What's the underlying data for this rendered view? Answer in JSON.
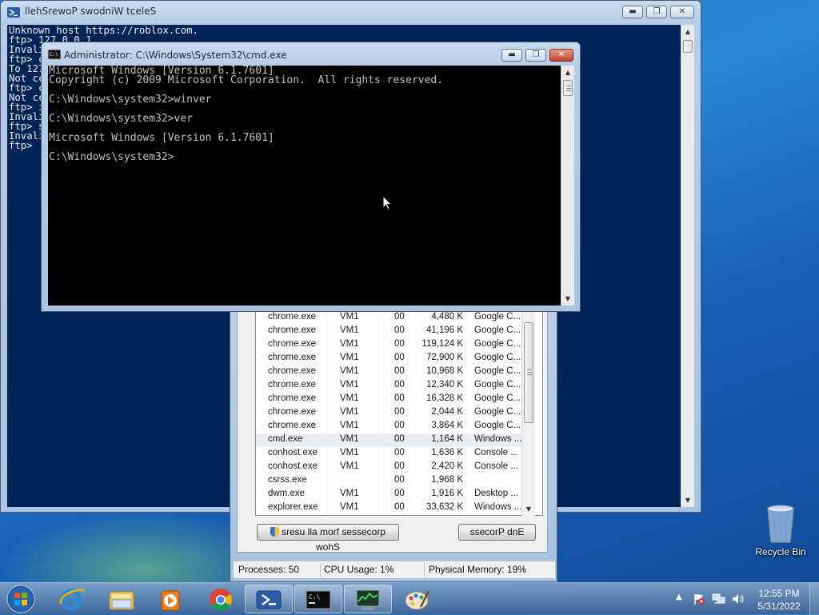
{
  "desktop": {
    "recycle_bin_label": "Recycle Bin"
  },
  "powershell": {
    "title": "llehSrewoP swodniW tceleS",
    "lines": [
      "Unknown host https://roblox.com.",
      "ftp> 127.0.0.1",
      "Invali",
      "ftp> c",
      "To 127",
      "Not cc",
      "ftp> c",
      "Not cc",
      "ftp> i",
      "Invali",
      "ftp> s",
      "Invali",
      "ftp> "
    ]
  },
  "cmd": {
    "title": "Administrator: C:\\Windows\\System32\\cmd.exe",
    "lines": [
      "Microsoft Windows [Version 6.1.7601]",
      "Copyright (c) 2009 Microsoft Corporation.  All rights reserved.",
      "",
      "C:\\Windows\\system32>winver",
      "",
      "C:\\Windows\\system32>ver",
      "",
      "Microsoft Windows [Version 6.1.7601]",
      "",
      "C:\\Windows\\system32>"
    ]
  },
  "taskmanager": {
    "processes": [
      {
        "image": "chrome.exe",
        "user": "VM1",
        "cpu": "00",
        "mem": "4,480 K",
        "desc": "Google C..."
      },
      {
        "image": "chrome.exe",
        "user": "VM1",
        "cpu": "00",
        "mem": "41,196 K",
        "desc": "Google C..."
      },
      {
        "image": "chrome.exe",
        "user": "VM1",
        "cpu": "00",
        "mem": "119,124 K",
        "desc": "Google C..."
      },
      {
        "image": "chrome.exe",
        "user": "VM1",
        "cpu": "00",
        "mem": "72,900 K",
        "desc": "Google C..."
      },
      {
        "image": "chrome.exe",
        "user": "VM1",
        "cpu": "00",
        "mem": "10,968 K",
        "desc": "Google C..."
      },
      {
        "image": "chrome.exe",
        "user": "VM1",
        "cpu": "00",
        "mem": "12,340 K",
        "desc": "Google C..."
      },
      {
        "image": "chrome.exe",
        "user": "VM1",
        "cpu": "00",
        "mem": "16,328 K",
        "desc": "Google C..."
      },
      {
        "image": "chrome.exe",
        "user": "VM1",
        "cpu": "00",
        "mem": "2,044 K",
        "desc": "Google C..."
      },
      {
        "image": "chrome.exe",
        "user": "VM1",
        "cpu": "00",
        "mem": "3,864 K",
        "desc": "Google C..."
      },
      {
        "image": "cmd.exe",
        "user": "VM1",
        "cpu": "00",
        "mem": "1,164 K",
        "desc": "Windows ...",
        "selected": true
      },
      {
        "image": "conhost.exe",
        "user": "VM1",
        "cpu": "00",
        "mem": "1,636 K",
        "desc": "Console ..."
      },
      {
        "image": "conhost.exe",
        "user": "VM1",
        "cpu": "00",
        "mem": "2,420 K",
        "desc": "Console ..."
      },
      {
        "image": "csrss.exe",
        "user": "",
        "cpu": "00",
        "mem": "1,968 K",
        "desc": ""
      },
      {
        "image": "dwm.exe",
        "user": "VM1",
        "cpu": "00",
        "mem": "1,916 K",
        "desc": "Desktop ..."
      },
      {
        "image": "explorer.exe",
        "user": "VM1",
        "cpu": "00",
        "mem": "33,632 K",
        "desc": "Windows ..."
      }
    ],
    "show_all_label": "sresu lla morf sessecorp wohS",
    "end_process_label": "ssecorP dnE",
    "status": {
      "processes": "Processes: 50",
      "cpu": "CPU Usage: 1%",
      "memory": "Physical Memory: 19%"
    }
  },
  "taskbar": {
    "items": [
      {
        "icon": "internet-explorer-icon"
      },
      {
        "icon": "file-explorer-icon"
      },
      {
        "icon": "media-player-icon"
      },
      {
        "icon": "chrome-icon"
      },
      {
        "icon": "powershell-icon",
        "active": true
      },
      {
        "icon": "cmd-icon",
        "active": true
      },
      {
        "icon": "task-manager-icon",
        "active": true
      },
      {
        "icon": "paint-icon"
      }
    ],
    "clock": {
      "time": "12:55 PM",
      "date": "5/31/2022"
    }
  }
}
